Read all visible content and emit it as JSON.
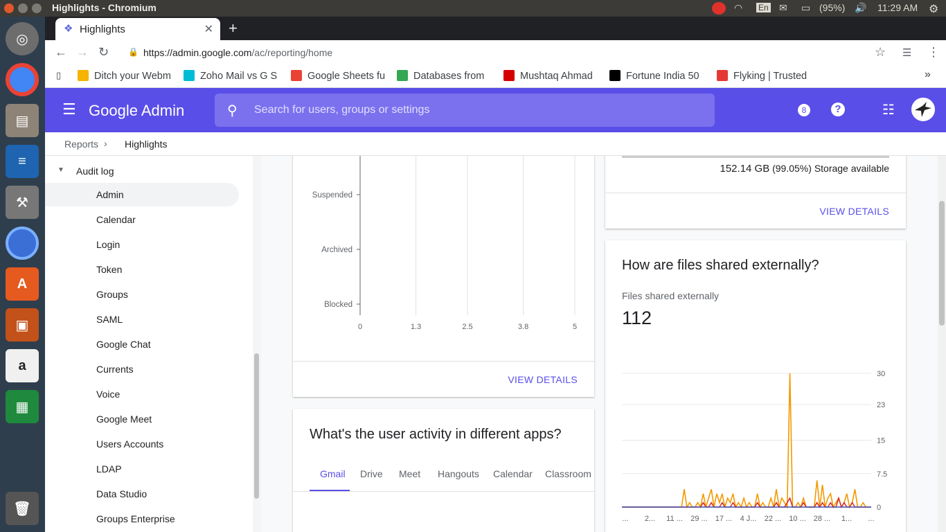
{
  "os": {
    "window_title": "Highlights - Chromium",
    "tray": {
      "keyboard": "En",
      "battery": "(95%)",
      "time": "11:29 AM"
    }
  },
  "browser": {
    "tab_title": "Highlights",
    "url_host": "https://admin.google.com",
    "url_path": "/ac/reporting/home",
    "bookmarks": [
      {
        "label": "Ditch your Webm",
        "color": "#f4b400"
      },
      {
        "label": "Zoho Mail vs G S",
        "color": "#00bcd4"
      },
      {
        "label": "Google Sheets fu",
        "color": "#ea4335"
      },
      {
        "label": "Databases from",
        "color": "#34a853"
      },
      {
        "label": "Mushtaq Ahmad",
        "color": "#d50000"
      },
      {
        "label": "Fortune India 50",
        "color": "#000000"
      },
      {
        "label": "Flyking | Trusted",
        "color": "#e53935"
      }
    ],
    "more_bookmarks": "»"
  },
  "admin": {
    "brand": "Google Admin",
    "search_placeholder": "Search for users, groups or settings",
    "support_badge": "8"
  },
  "breadcrumb": {
    "parent": "Reports",
    "separator": "›",
    "current": "Highlights"
  },
  "sidebar": {
    "section": "Audit log",
    "items": [
      "Admin",
      "Calendar",
      "Login",
      "Token",
      "Groups",
      "SAML",
      "Google Chat",
      "Currents",
      "Voice",
      "Google Meet",
      "Users Accounts",
      "LDAP",
      "Data Studio",
      "Groups Enterprise"
    ],
    "active": "Admin"
  },
  "user_status_card": {
    "rows": [
      "Suspended",
      "Archived",
      "Blocked"
    ],
    "x_ticks": [
      "0",
      "1.3",
      "2.5",
      "3.8",
      "5"
    ],
    "view_details": "VIEW DETAILS"
  },
  "storage_card": {
    "used_value": "152.14 GB",
    "percent": "(99.05%)",
    "suffix": "Storage available",
    "view_details": "VIEW DETAILS"
  },
  "activity_card": {
    "title": "What's the user activity in different apps?",
    "tabs": [
      "Gmail",
      "Drive",
      "Meet",
      "Hangouts",
      "Calendar",
      "Classroom"
    ],
    "active_tab": "Gmail"
  },
  "sharing_card": {
    "title": "How are files shared externally?",
    "metric_label": "Files shared externally",
    "metric_value": "112",
    "y_ticks": [
      "30",
      "23",
      "15",
      "7.5",
      "0"
    ],
    "x_ticks": [
      "...",
      "2...",
      "11 ...",
      "29 ...",
      "17 ...",
      "4 J...",
      "22 ...",
      "10 ...",
      "28 ...",
      "1...",
      "..."
    ]
  },
  "chart_data": [
    {
      "type": "bar",
      "categories": [
        "Suspended",
        "Archived",
        "Blocked"
      ],
      "values": [
        0,
        0,
        0
      ],
      "xlim": [
        0,
        5
      ],
      "x_ticks": [
        0,
        1.3,
        2.5,
        3.8,
        5
      ],
      "title": "",
      "xlabel": "",
      "ylabel": "",
      "grid": true
    },
    {
      "type": "line",
      "ylim": [
        0,
        30
      ],
      "y_ticks": [
        0,
        7.5,
        15,
        23,
        30
      ],
      "series": [
        {
          "color": "#f29900",
          "values": [
            0,
            0,
            0,
            0,
            0,
            0,
            0,
            0,
            0,
            0,
            0,
            0,
            0,
            0,
            0,
            0,
            0,
            0,
            0,
            0,
            0,
            0,
            0,
            4,
            0,
            1,
            0,
            0,
            1,
            0,
            3,
            0,
            2,
            4,
            0,
            3,
            1,
            3,
            0,
            2,
            1,
            3,
            0,
            1,
            0,
            2,
            0,
            1,
            0,
            0,
            3,
            0,
            1,
            0,
            0,
            2,
            0,
            4,
            0,
            2,
            1,
            0,
            30,
            0,
            0,
            1,
            0,
            2,
            0,
            0,
            0,
            0,
            6,
            0,
            5,
            0,
            2,
            3,
            0,
            1,
            2,
            0,
            1,
            3,
            0,
            1,
            4,
            0,
            0,
            1,
            0,
            0,
            0
          ]
        },
        {
          "color": "#d93025",
          "values": [
            0,
            0,
            0,
            0,
            0,
            0,
            0,
            0,
            0,
            0,
            0,
            0,
            0,
            0,
            0,
            0,
            0,
            0,
            0,
            0,
            0,
            0,
            0,
            0,
            0,
            0,
            0,
            0,
            0,
            0,
            1,
            0,
            0,
            1,
            0,
            0,
            0,
            1,
            0,
            0,
            0,
            1,
            0,
            0,
            0,
            0,
            0,
            0,
            0,
            0,
            1,
            0,
            0,
            0,
            0,
            0,
            0,
            1,
            0,
            0,
            0,
            1,
            2,
            0,
            0,
            0,
            0,
            1,
            0,
            0,
            0,
            0,
            1,
            0,
            1,
            0,
            0,
            1,
            0,
            0,
            2,
            0,
            1,
            0,
            0,
            1,
            0,
            0,
            0,
            0,
            0,
            0,
            0
          ]
        },
        {
          "color": "#3f51b5",
          "values": [
            0,
            0,
            0,
            0,
            0,
            0,
            0,
            0,
            0,
            0,
            0,
            0,
            0,
            0,
            0,
            0,
            0,
            0,
            0,
            0,
            0,
            0,
            0,
            0,
            0,
            0,
            0,
            0,
            0,
            0,
            0,
            0,
            0,
            0,
            0,
            0,
            0,
            0,
            0,
            0,
            0,
            0,
            0,
            0,
            0,
            0,
            0,
            0,
            0,
            0,
            0,
            0,
            0,
            0,
            0,
            0,
            0,
            0,
            0,
            0,
            0,
            0,
            0,
            0,
            0,
            0,
            0,
            0,
            0,
            0,
            0,
            0,
            0,
            0,
            0,
            0,
            0,
            0,
            0,
            0,
            0,
            0,
            0,
            0,
            0,
            0,
            0,
            0,
            0,
            0,
            0,
            0,
            0
          ]
        }
      ],
      "title": "",
      "xlabel": "",
      "ylabel": "",
      "grid": true
    }
  ]
}
